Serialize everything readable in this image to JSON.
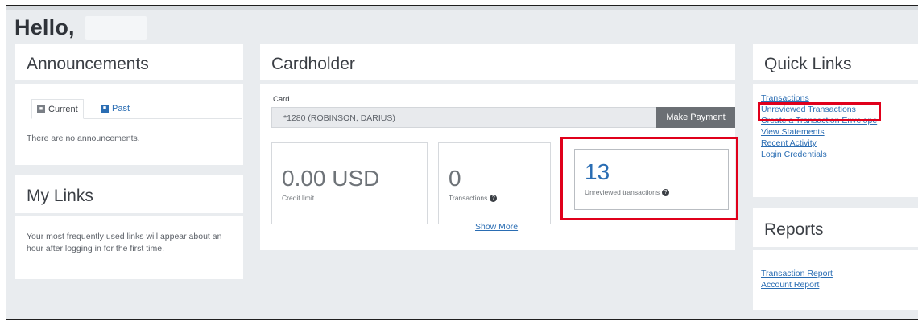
{
  "greeting": "Hello,",
  "announcements": {
    "title": "Announcements",
    "tabs": [
      {
        "label": "Current"
      },
      {
        "label": "Past"
      }
    ],
    "empty_text": "There are no announcements."
  },
  "my_links": {
    "title": "My Links",
    "text": "Your most frequently used links will appear about an hour after logging in for the first time."
  },
  "cardholder": {
    "title": "Cardholder",
    "card_label": "Card",
    "card_value": "*1280 (ROBINSON, DARIUS)",
    "make_payment": "Make Payment",
    "stats": [
      {
        "value": "0.00 USD",
        "label": "Credit limit"
      },
      {
        "value": "0",
        "label": "Transactions"
      },
      {
        "value": "13",
        "label": "Unreviewed transactions"
      }
    ],
    "show_more": "Show More"
  },
  "quick_links": {
    "title": "Quick Links",
    "items": [
      {
        "label": "Transactions"
      },
      {
        "label": "Unreviewed Transactions"
      },
      {
        "label": "Create a Transaction Envelope"
      },
      {
        "label": "View Statements"
      },
      {
        "label": "Recent Activity"
      },
      {
        "label": "Login Credentials"
      }
    ]
  },
  "reports": {
    "title": "Reports",
    "items": [
      {
        "label": "Transaction Report"
      },
      {
        "label": "Account Report"
      }
    ]
  },
  "colors": {
    "link": "#2a6db3",
    "highlight": "#e0001b",
    "stat_accent": "#2a6db3"
  }
}
